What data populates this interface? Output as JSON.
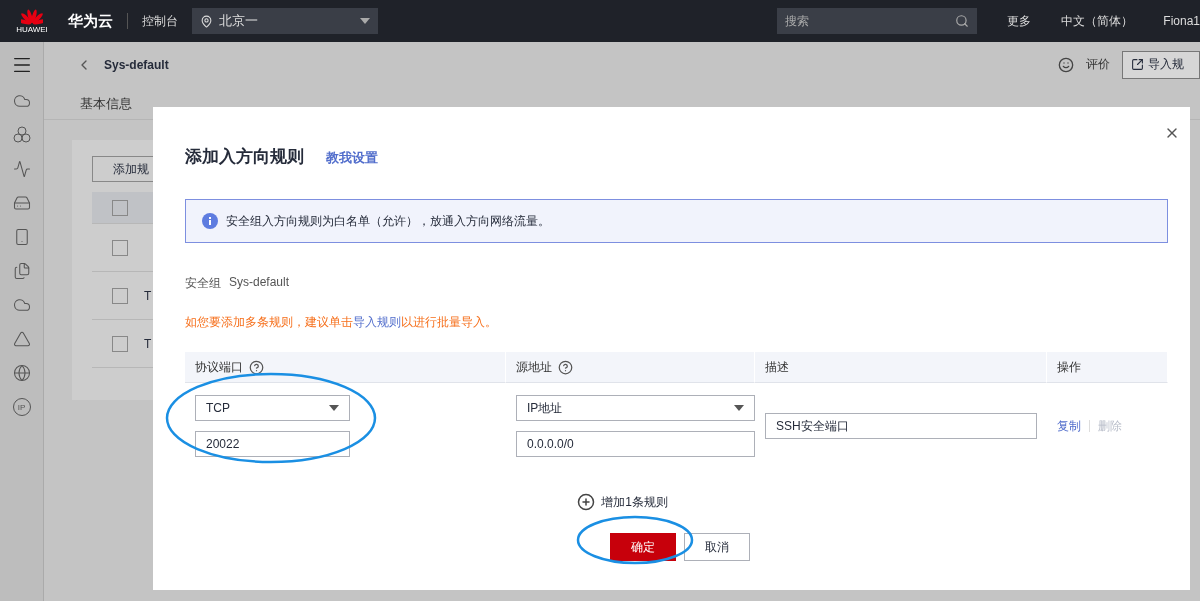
{
  "topbar": {
    "brand_mark": "HUAWEI",
    "brand": "华为云",
    "console": "控制台",
    "region": "北京一",
    "search": {
      "placeholder": "搜索"
    },
    "links": [
      "更多",
      "中文（简体）",
      "Fiona1"
    ]
  },
  "sidebar": {
    "items": [
      {
        "kind": "menu"
      },
      {
        "kind": "cloud"
      },
      {
        "kind": "circles"
      },
      {
        "kind": "wave"
      },
      {
        "kind": "drive"
      },
      {
        "kind": "device"
      },
      {
        "kind": "files"
      },
      {
        "kind": "cloud"
      },
      {
        "kind": "triangle"
      },
      {
        "kind": "globe"
      },
      {
        "kind": "text",
        "label": "IP"
      }
    ]
  },
  "header": {
    "title": "Sys-default",
    "feedback": "评价",
    "import_button": "导入规"
  },
  "tabs": [
    {
      "label": "基本信息",
      "selected": false
    }
  ],
  "background_table": {
    "add_button": "添加规",
    "rows": [
      {
        "header": true
      },
      {
        "header": false
      },
      {
        "text": "T",
        "header": false
      },
      {
        "text": "T",
        "header": false
      }
    ]
  },
  "dialog": {
    "title": "添加入方向规则",
    "help_link": "教我设置",
    "info": "安全组入方向规则为白名单（允许），放通入方向网络流量。",
    "group_label": "安全组",
    "group_value": "Sys-default",
    "hint": {
      "before": "如您要添加多条规则，建议单击",
      "link": "导入规则",
      "after": "以进行批量导入。"
    },
    "columns": [
      {
        "label": "协议端口",
        "help": true
      },
      {
        "label": "源地址",
        "help": true
      },
      {
        "label": "描述",
        "help": false
      },
      {
        "label": "操作",
        "help": false
      }
    ],
    "rules": [
      {
        "protocol": "TCP",
        "port": "20022",
        "source_type": "IP地址",
        "source": "0.0.0.0/0",
        "description": "SSH安全端口",
        "actions": [
          {
            "label": "复制",
            "disabled": false
          },
          {
            "label": "删除",
            "disabled": true
          }
        ]
      }
    ],
    "add_rule": "增加1条规则",
    "confirm": "确定",
    "cancel": "取消"
  }
}
